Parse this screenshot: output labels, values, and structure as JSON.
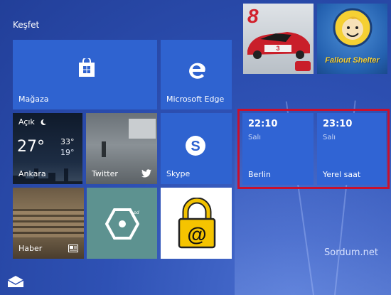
{
  "group": {
    "title": "Keşfet"
  },
  "tiles": {
    "store": {
      "label": "Mağaza"
    },
    "edge": {
      "label": "Microsoft Edge"
    },
    "weather": {
      "condition": "Açık",
      "temp": "27°",
      "high": "33°",
      "low": "19°",
      "city": "Ankara"
    },
    "twitter": {
      "label": "Twitter"
    },
    "skype": {
      "label": "Skype"
    },
    "news": {
      "label": "Haber"
    },
    "asphalt": {
      "badge": "8"
    },
    "fallout": {
      "logo_text": "Fallout Shelter"
    },
    "clock_berlin": {
      "time": "22:10",
      "day": "Salı",
      "city": "Berlin"
    },
    "clock_local": {
      "time": "23:10",
      "day": "Salı",
      "city": "Yerel saat"
    }
  },
  "watermark": "Sordum.net",
  "colors": {
    "tile_blue": "#2f63d0",
    "highlight": "#c8102e",
    "background": "#2e51b4"
  }
}
